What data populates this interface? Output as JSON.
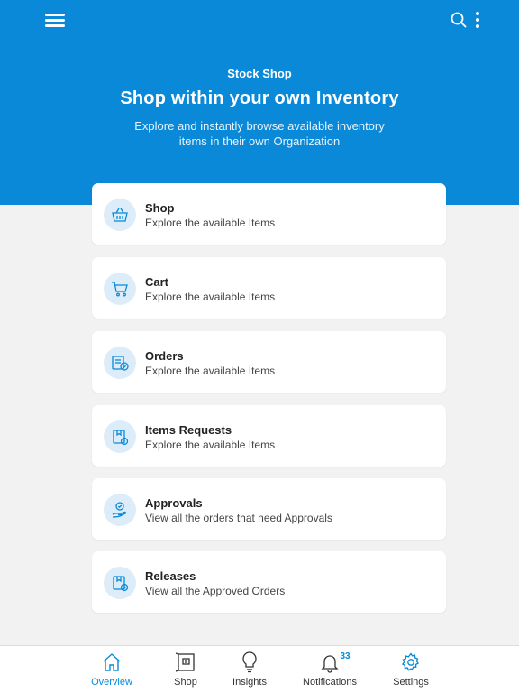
{
  "header": {
    "subtitle": "Stock Shop",
    "title": "Shop within your own Inventory",
    "description": "Explore and instantly browse available inventory items in their own  Organization"
  },
  "icons": {
    "menu": "hamburger-menu-icon",
    "search": "search-icon",
    "more": "more-vertical-icon"
  },
  "cards": [
    {
      "title": "Shop",
      "subtitle": "Explore the available Items",
      "icon": "basket-icon"
    },
    {
      "title": "Cart",
      "subtitle": "Explore the available Items",
      "icon": "cart-icon"
    },
    {
      "title": "Orders",
      "subtitle": "Explore the available Items",
      "icon": "orders-icon"
    },
    {
      "title": "Items Requests",
      "subtitle": "Explore the available Items",
      "icon": "box-request-icon"
    },
    {
      "title": "Approvals",
      "subtitle": "View all the orders that need Approvals",
      "icon": "approval-hand-icon"
    },
    {
      "title": "Releases",
      "subtitle": "View all the Approved Orders",
      "icon": "release-box-icon"
    }
  ],
  "tabs": [
    {
      "label": "Overview",
      "icon": "home-icon",
      "active": true
    },
    {
      "label": "Shop",
      "icon": "shop-box-icon",
      "active": false
    },
    {
      "label": "Insights",
      "icon": "lightbulb-icon",
      "active": false
    },
    {
      "label": "Notifications",
      "icon": "bell-icon",
      "active": false,
      "badge": "33"
    },
    {
      "label": "Settings",
      "icon": "gear-icon",
      "active": false
    }
  ],
  "colors": {
    "primary": "#0989d8",
    "icon_bg": "#dcedf9",
    "background": "#f2f2f2"
  }
}
